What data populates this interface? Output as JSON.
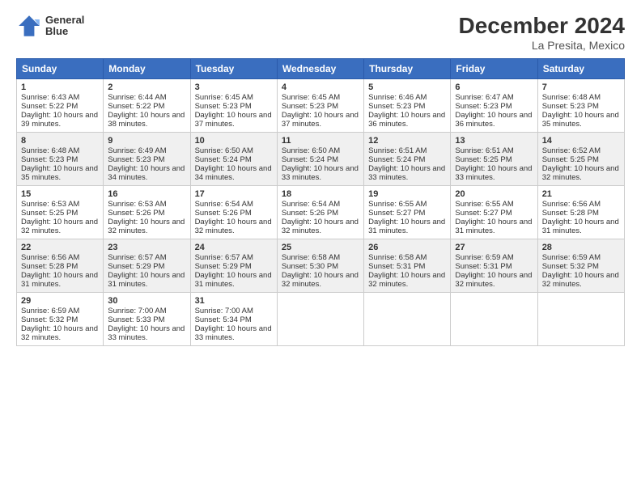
{
  "header": {
    "logo": {
      "line1": "General",
      "line2": "Blue"
    },
    "title": "December 2024",
    "subtitle": "La Presita, Mexico"
  },
  "calendar": {
    "headers": [
      "Sunday",
      "Monday",
      "Tuesday",
      "Wednesday",
      "Thursday",
      "Friday",
      "Saturday"
    ],
    "rows": [
      [
        {
          "day": "1",
          "sunrise": "Sunrise: 6:43 AM",
          "sunset": "Sunset: 5:22 PM",
          "daylight": "Daylight: 10 hours and 39 minutes."
        },
        {
          "day": "2",
          "sunrise": "Sunrise: 6:44 AM",
          "sunset": "Sunset: 5:22 PM",
          "daylight": "Daylight: 10 hours and 38 minutes."
        },
        {
          "day": "3",
          "sunrise": "Sunrise: 6:45 AM",
          "sunset": "Sunset: 5:23 PM",
          "daylight": "Daylight: 10 hours and 37 minutes."
        },
        {
          "day": "4",
          "sunrise": "Sunrise: 6:45 AM",
          "sunset": "Sunset: 5:23 PM",
          "daylight": "Daylight: 10 hours and 37 minutes."
        },
        {
          "day": "5",
          "sunrise": "Sunrise: 6:46 AM",
          "sunset": "Sunset: 5:23 PM",
          "daylight": "Daylight: 10 hours and 36 minutes."
        },
        {
          "day": "6",
          "sunrise": "Sunrise: 6:47 AM",
          "sunset": "Sunset: 5:23 PM",
          "daylight": "Daylight: 10 hours and 36 minutes."
        },
        {
          "day": "7",
          "sunrise": "Sunrise: 6:48 AM",
          "sunset": "Sunset: 5:23 PM",
          "daylight": "Daylight: 10 hours and 35 minutes."
        }
      ],
      [
        {
          "day": "8",
          "sunrise": "Sunrise: 6:48 AM",
          "sunset": "Sunset: 5:23 PM",
          "daylight": "Daylight: 10 hours and 35 minutes."
        },
        {
          "day": "9",
          "sunrise": "Sunrise: 6:49 AM",
          "sunset": "Sunset: 5:23 PM",
          "daylight": "Daylight: 10 hours and 34 minutes."
        },
        {
          "day": "10",
          "sunrise": "Sunrise: 6:50 AM",
          "sunset": "Sunset: 5:24 PM",
          "daylight": "Daylight: 10 hours and 34 minutes."
        },
        {
          "day": "11",
          "sunrise": "Sunrise: 6:50 AM",
          "sunset": "Sunset: 5:24 PM",
          "daylight": "Daylight: 10 hours and 33 minutes."
        },
        {
          "day": "12",
          "sunrise": "Sunrise: 6:51 AM",
          "sunset": "Sunset: 5:24 PM",
          "daylight": "Daylight: 10 hours and 33 minutes."
        },
        {
          "day": "13",
          "sunrise": "Sunrise: 6:51 AM",
          "sunset": "Sunset: 5:25 PM",
          "daylight": "Daylight: 10 hours and 33 minutes."
        },
        {
          "day": "14",
          "sunrise": "Sunrise: 6:52 AM",
          "sunset": "Sunset: 5:25 PM",
          "daylight": "Daylight: 10 hours and 32 minutes."
        }
      ],
      [
        {
          "day": "15",
          "sunrise": "Sunrise: 6:53 AM",
          "sunset": "Sunset: 5:25 PM",
          "daylight": "Daylight: 10 hours and 32 minutes."
        },
        {
          "day": "16",
          "sunrise": "Sunrise: 6:53 AM",
          "sunset": "Sunset: 5:26 PM",
          "daylight": "Daylight: 10 hours and 32 minutes."
        },
        {
          "day": "17",
          "sunrise": "Sunrise: 6:54 AM",
          "sunset": "Sunset: 5:26 PM",
          "daylight": "Daylight: 10 hours and 32 minutes."
        },
        {
          "day": "18",
          "sunrise": "Sunrise: 6:54 AM",
          "sunset": "Sunset: 5:26 PM",
          "daylight": "Daylight: 10 hours and 32 minutes."
        },
        {
          "day": "19",
          "sunrise": "Sunrise: 6:55 AM",
          "sunset": "Sunset: 5:27 PM",
          "daylight": "Daylight: 10 hours and 31 minutes."
        },
        {
          "day": "20",
          "sunrise": "Sunrise: 6:55 AM",
          "sunset": "Sunset: 5:27 PM",
          "daylight": "Daylight: 10 hours and 31 minutes."
        },
        {
          "day": "21",
          "sunrise": "Sunrise: 6:56 AM",
          "sunset": "Sunset: 5:28 PM",
          "daylight": "Daylight: 10 hours and 31 minutes."
        }
      ],
      [
        {
          "day": "22",
          "sunrise": "Sunrise: 6:56 AM",
          "sunset": "Sunset: 5:28 PM",
          "daylight": "Daylight: 10 hours and 31 minutes."
        },
        {
          "day": "23",
          "sunrise": "Sunrise: 6:57 AM",
          "sunset": "Sunset: 5:29 PM",
          "daylight": "Daylight: 10 hours and 31 minutes."
        },
        {
          "day": "24",
          "sunrise": "Sunrise: 6:57 AM",
          "sunset": "Sunset: 5:29 PM",
          "daylight": "Daylight: 10 hours and 31 minutes."
        },
        {
          "day": "25",
          "sunrise": "Sunrise: 6:58 AM",
          "sunset": "Sunset: 5:30 PM",
          "daylight": "Daylight: 10 hours and 32 minutes."
        },
        {
          "day": "26",
          "sunrise": "Sunrise: 6:58 AM",
          "sunset": "Sunset: 5:31 PM",
          "daylight": "Daylight: 10 hours and 32 minutes."
        },
        {
          "day": "27",
          "sunrise": "Sunrise: 6:59 AM",
          "sunset": "Sunset: 5:31 PM",
          "daylight": "Daylight: 10 hours and 32 minutes."
        },
        {
          "day": "28",
          "sunrise": "Sunrise: 6:59 AM",
          "sunset": "Sunset: 5:32 PM",
          "daylight": "Daylight: 10 hours and 32 minutes."
        }
      ],
      [
        {
          "day": "29",
          "sunrise": "Sunrise: 6:59 AM",
          "sunset": "Sunset: 5:32 PM",
          "daylight": "Daylight: 10 hours and 32 minutes."
        },
        {
          "day": "30",
          "sunrise": "Sunrise: 7:00 AM",
          "sunset": "Sunset: 5:33 PM",
          "daylight": "Daylight: 10 hours and 33 minutes."
        },
        {
          "day": "31",
          "sunrise": "Sunrise: 7:00 AM",
          "sunset": "Sunset: 5:34 PM",
          "daylight": "Daylight: 10 hours and 33 minutes."
        },
        null,
        null,
        null,
        null
      ]
    ]
  }
}
